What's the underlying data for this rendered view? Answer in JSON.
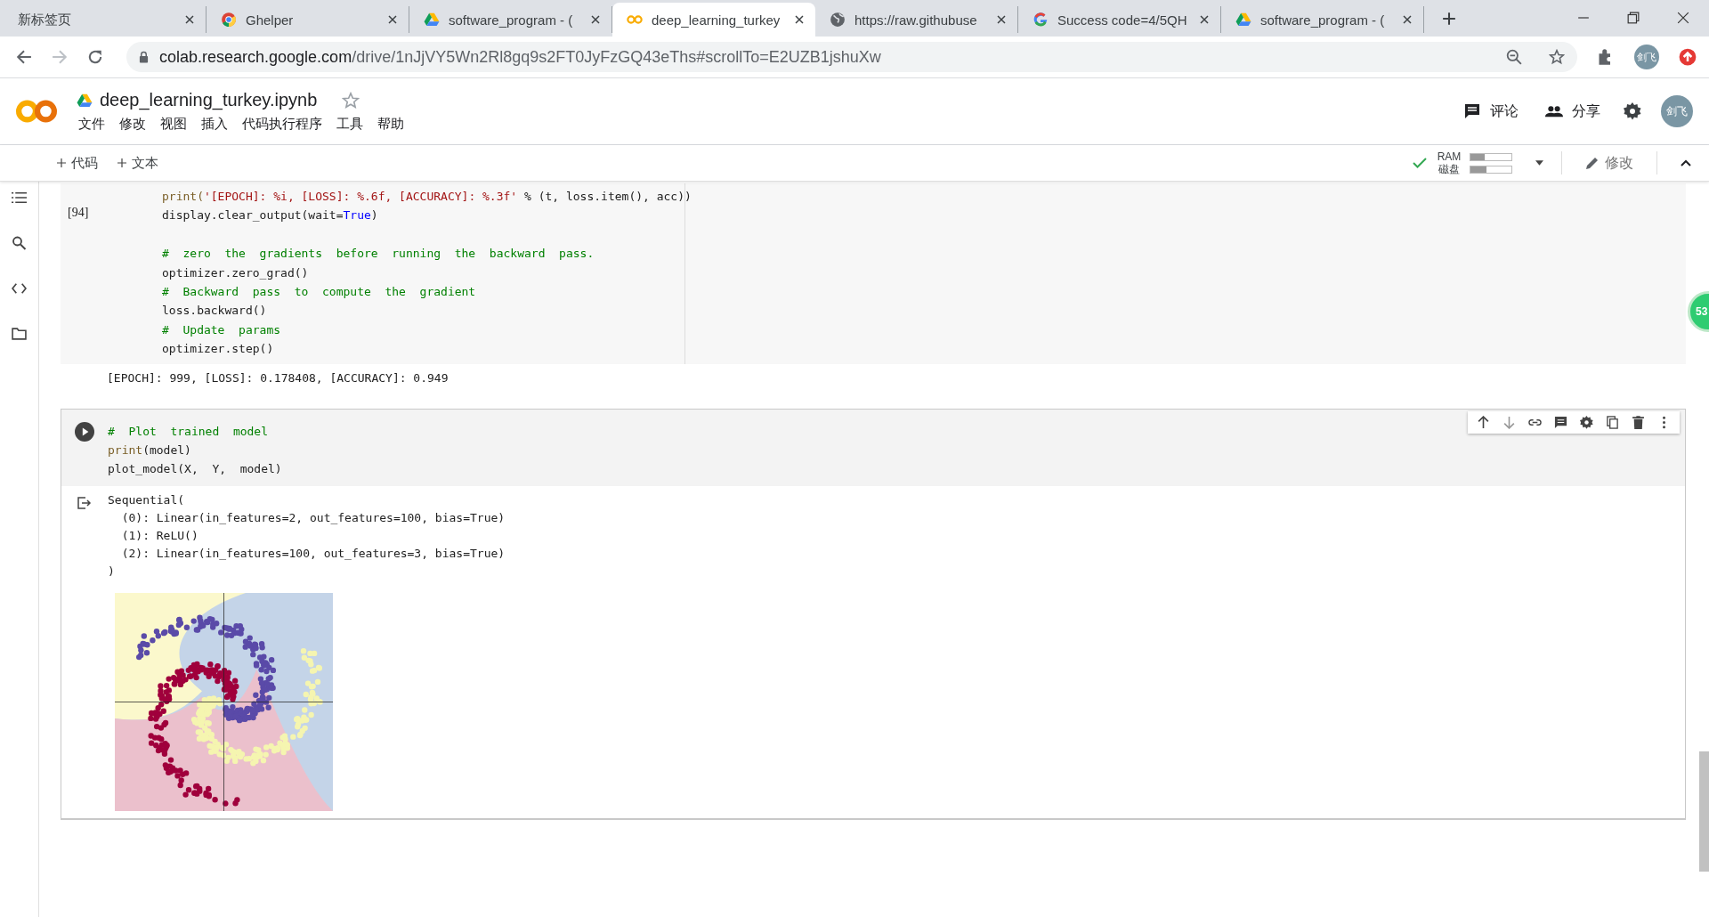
{
  "browser": {
    "tabs": [
      {
        "title": "新标签页",
        "kind": "blank",
        "selected": false
      },
      {
        "title": "Ghelper",
        "kind": "extension",
        "selected": false
      },
      {
        "title": "software_program - (",
        "kind": "drive",
        "selected": false
      },
      {
        "title": "deep_learning_turkey",
        "kind": "notebook",
        "selected": true
      },
      {
        "title": "https://raw.githubuse",
        "kind": "web",
        "selected": false
      },
      {
        "title": "Success code=4/5QH",
        "kind": "search",
        "selected": false
      },
      {
        "title": "software_program - (",
        "kind": "drive",
        "selected": false
      }
    ],
    "address_host": "colab.research.google.com",
    "address_path": "/drive/1nJjVY5Wn2Rl8gq9s2FT0JyFzGQ43eThs#scrollTo=E2UZB1jshuXw",
    "profile": "剑飞"
  },
  "notebook": {
    "title": "deep_learning_turkey.ipynb",
    "starred": false,
    "menu": [
      "文件",
      "修改",
      "视图",
      "插入",
      "代码执行程序",
      "工具",
      "帮助"
    ],
    "actions": [
      {
        "label": "评论",
        "kind": "comment"
      },
      {
        "label": "分享",
        "kind": "share"
      }
    ],
    "avatar": "剑飞"
  },
  "toolbar": {
    "insert": [
      "代码",
      "文本"
    ],
    "connected": true,
    "resources": [
      {
        "label": "RAM",
        "level": 0.35
      },
      {
        "label": "磁盘",
        "level": 0.4
      }
    ],
    "edit_label": "修改"
  },
  "cells": [
    {
      "selected": false,
      "exec_count": "[94]",
      "lines": [
        [
          {
            "text": "print(",
            "kind": "builtin"
          },
          {
            "text": "'[EPOCH]: %i, [LOSS]: %.6f, [ACCURACY]: %.3f'",
            "kind": "string"
          },
          {
            "text": " % (t, loss.item(), acc))",
            "kind": "plain"
          }
        ],
        [
          {
            "text": "display.clear_output(wait=",
            "kind": "plain"
          },
          {
            "text": "True",
            "kind": "keyword"
          },
          {
            "text": ")",
            "kind": "plain"
          }
        ],
        [
          {
            "gap": true,
            "text": "#  zero  the  gradients  before  running  the  backward  pass.",
            "kind": "comment"
          }
        ],
        [
          {
            "text": "optimizer.zero_grad()",
            "kind": "plain"
          }
        ],
        [
          {
            "text": "#  Backward  pass  to  compute  the  gradient",
            "kind": "comment"
          }
        ],
        [
          {
            "text": "loss.backward()",
            "kind": "plain"
          }
        ],
        [
          {
            "text": "#  Update  params",
            "kind": "comment"
          }
        ],
        [
          {
            "text": "optimizer.step()",
            "kind": "plain"
          }
        ]
      ],
      "outputs": [
        {
          "kind": "text",
          "lines": [
            "[EPOCH]: 999, [LOSS]: 0.178408, [ACCURACY]: 0.949"
          ]
        }
      ]
    },
    {
      "selected": true,
      "lines": [
        [
          {
            "text": "#  Plot  trained  model",
            "kind": "comment"
          }
        ],
        [
          {
            "text": "print",
            "kind": "builtin"
          },
          {
            "text": "(model)",
            "kind": "plain"
          }
        ],
        [
          {
            "text": "plot_model(X,  Y,  model)",
            "kind": "plain"
          }
        ]
      ],
      "outputs": [
        {
          "kind": "text",
          "lines": [
            "Sequential(",
            "  (0): Linear(in_features=2, out_features=100, bias=True)",
            "  (1): ReLU()",
            "  (2): Linear(in_features=100, out_features=3, bias=True)",
            ")"
          ]
        },
        {
          "kind": "plot"
        }
      ]
    }
  ],
  "side_badge": "53"
}
